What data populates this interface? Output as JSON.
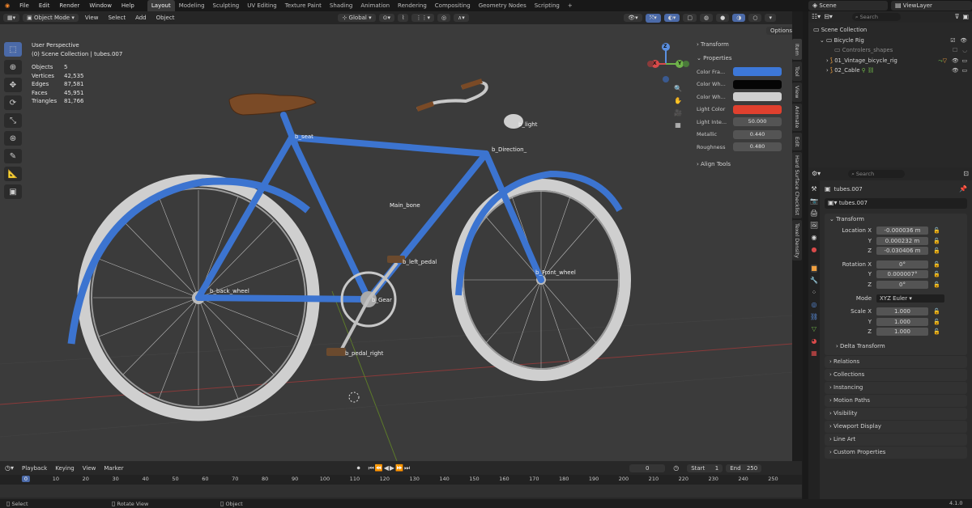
{
  "menu": [
    "File",
    "Edit",
    "Render",
    "Window",
    "Help"
  ],
  "workspaces": [
    "Layout",
    "Modeling",
    "Sculpting",
    "UV Editing",
    "Texture Paint",
    "Shading",
    "Animation",
    "Rendering",
    "Compositing",
    "Geometry Nodes",
    "Scripting"
  ],
  "active_workspace": "Layout",
  "scene_name": "Scene",
  "view_layer": "ViewLayer",
  "header": {
    "mode": "Object Mode",
    "view": "View",
    "select": "Select",
    "add": "Add",
    "object": "Object",
    "transform_orientation": "Global",
    "options": "Options"
  },
  "viewport": {
    "perspective": "User Perspective",
    "collection": "(0) Scene Collection | tubes.007",
    "stats": [
      {
        "label": "Objects",
        "value": "5"
      },
      {
        "label": "Vertices",
        "value": "42,535"
      },
      {
        "label": "Edges",
        "value": "87,581"
      },
      {
        "label": "Faces",
        "value": "45,951"
      },
      {
        "label": "Triangles",
        "value": "81,766"
      }
    ],
    "bones": [
      "b_seat",
      "b_light",
      "b_Direction_",
      "Main_bone",
      "b_left_pedal",
      "b_back_wheel",
      "b_Front_wheel",
      "b_Gear",
      "b_pedal_right"
    ],
    "gizmo": {
      "z": "Z",
      "x": "X",
      "y": "Y"
    }
  },
  "npanel": {
    "transform": "Transform",
    "properties": "Properties",
    "rows": [
      {
        "label": "Color Fra...",
        "value": "",
        "color": "#3d78d8"
      },
      {
        "label": "Color Wh...",
        "value": "",
        "color": "#050505"
      },
      {
        "label": "Color Wh...",
        "value": "",
        "color": "#cfcfcf"
      },
      {
        "label": "Light Color",
        "value": "",
        "color": "#e0402e"
      },
      {
        "label": "Light Inte...",
        "value": "50.000",
        "color": ""
      },
      {
        "label": "Metallic",
        "value": "0.440",
        "color": ""
      },
      {
        "label": "Roughness",
        "value": "0.480",
        "color": ""
      }
    ],
    "align_tools": "Align Tools",
    "tabs": [
      "Item",
      "Tool",
      "View",
      "Animate",
      "Edit",
      "Hard Surface Checklist",
      "Texel Density"
    ]
  },
  "outliner": {
    "search_placeholder": "Search",
    "items": [
      "Scene Collection",
      "Bicycle Rig",
      "Controlers_shapes",
      "01_Vintage_bicycle_rig",
      "02_Cable"
    ]
  },
  "properties_editor": {
    "search_placeholder": "Search",
    "object_name": "tubes.007",
    "object_field": "tubes.007",
    "transform": "Transform",
    "location": [
      {
        "label": "Location X",
        "value": "-0.000036 m"
      },
      {
        "label": "Y",
        "value": "0.000232 m"
      },
      {
        "label": "Z",
        "value": "-0.030406 m"
      }
    ],
    "rotation": [
      {
        "label": "Rotation X",
        "value": "0°"
      },
      {
        "label": "Y",
        "value": "0.000007°"
      },
      {
        "label": "Z",
        "value": "0°"
      }
    ],
    "mode_label": "Mode",
    "mode_value": "XYZ Euler",
    "scale": [
      {
        "label": "Scale X",
        "value": "1.000"
      },
      {
        "label": "Y",
        "value": "1.000"
      },
      {
        "label": "Z",
        "value": "1.000"
      }
    ],
    "delta_transform": "Delta Transform",
    "sections": [
      "Relations",
      "Collections",
      "Instancing",
      "Motion Paths",
      "Visibility",
      "Viewport Display",
      "Line Art",
      "Custom Properties"
    ]
  },
  "timeline": {
    "playback": "Playback",
    "keying": "Keying",
    "view": "View",
    "marker": "Marker",
    "current_frame": "0",
    "start_label": "Start",
    "start": "1",
    "end_label": "End",
    "end": "250",
    "ticks": [
      "0",
      "10",
      "20",
      "30",
      "40",
      "50",
      "60",
      "70",
      "80",
      "90",
      "100",
      "110",
      "120",
      "130",
      "140",
      "150",
      "160",
      "170",
      "180",
      "190",
      "200",
      "210",
      "220",
      "230",
      "240",
      "250"
    ],
    "current_marker": "0"
  },
  "status": {
    "select": "Select",
    "rotate": "Rotate View",
    "object": "Object",
    "version": "4.1.0"
  }
}
